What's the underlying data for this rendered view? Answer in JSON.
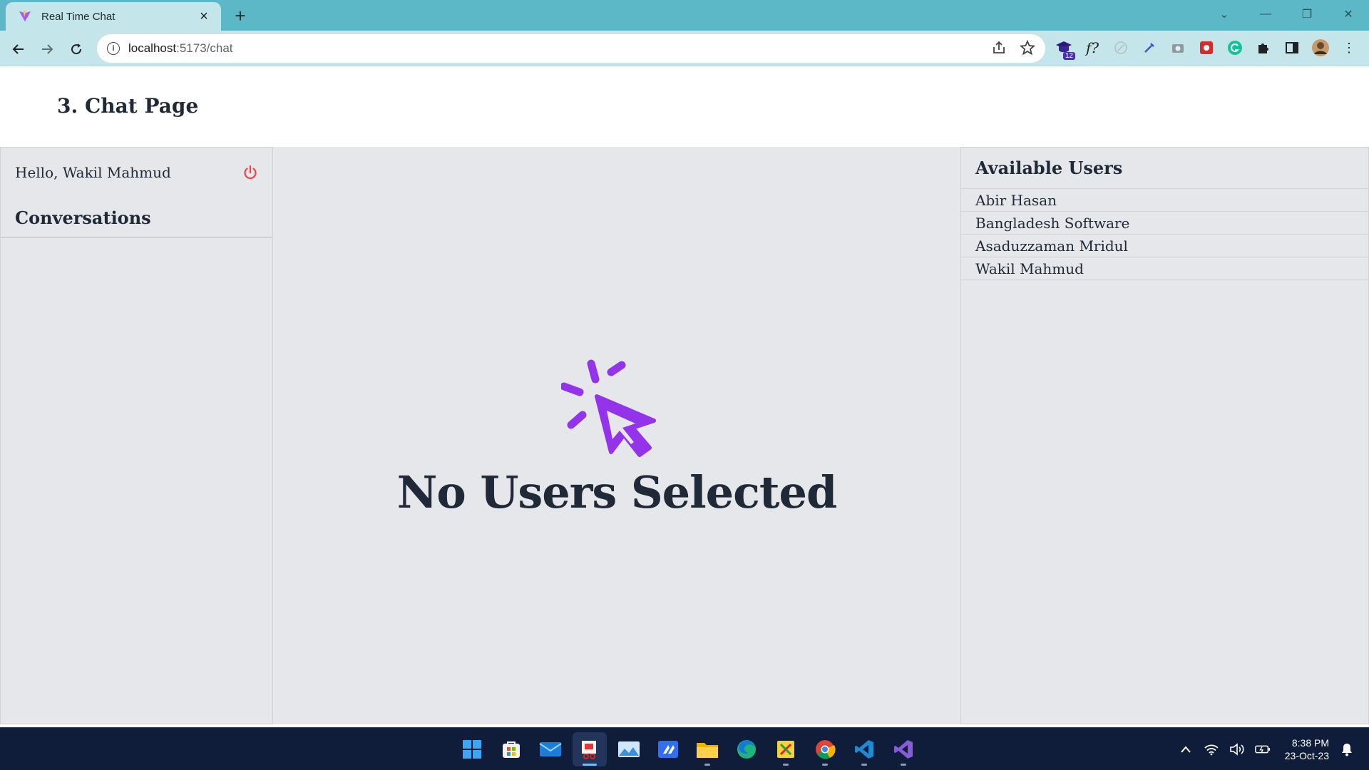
{
  "browser": {
    "tab_title": "Real Time Chat",
    "url_host": "localhost",
    "url_path": ":5173/chat",
    "extension_badge": "12",
    "extension_text": "f?"
  },
  "page": {
    "title": "3. Chat Page"
  },
  "sidebar": {
    "greeting": "Hello, Wakil Mahmud",
    "conversations_title": "Conversations",
    "conversations": []
  },
  "main": {
    "empty_state": "No Users Selected",
    "accent_color": "#9333ea"
  },
  "users_panel": {
    "title": "Available Users",
    "users": [
      {
        "name": "Abir Hasan"
      },
      {
        "name": "Bangladesh Software"
      },
      {
        "name": "Asaduzzaman Mridul"
      },
      {
        "name": "Wakil Mahmud"
      }
    ]
  },
  "taskbar": {
    "time": "8:38 PM",
    "date": "23-Oct-23",
    "apps": [
      "windows-start-icon",
      "microsoft-store-icon",
      "mail-icon",
      "snipping-tool-icon",
      "photos-icon",
      "visual-studio-code-alt-icon",
      "file-explorer-icon",
      "edge-icon",
      "sticky-app-icon",
      "chrome-icon",
      "vscode-icon",
      "visual-studio-icon"
    ]
  },
  "colors": {
    "logout": "#ef4444",
    "tab_bar": "#5cb8c6",
    "panel_bg": "#e5e7eb"
  }
}
